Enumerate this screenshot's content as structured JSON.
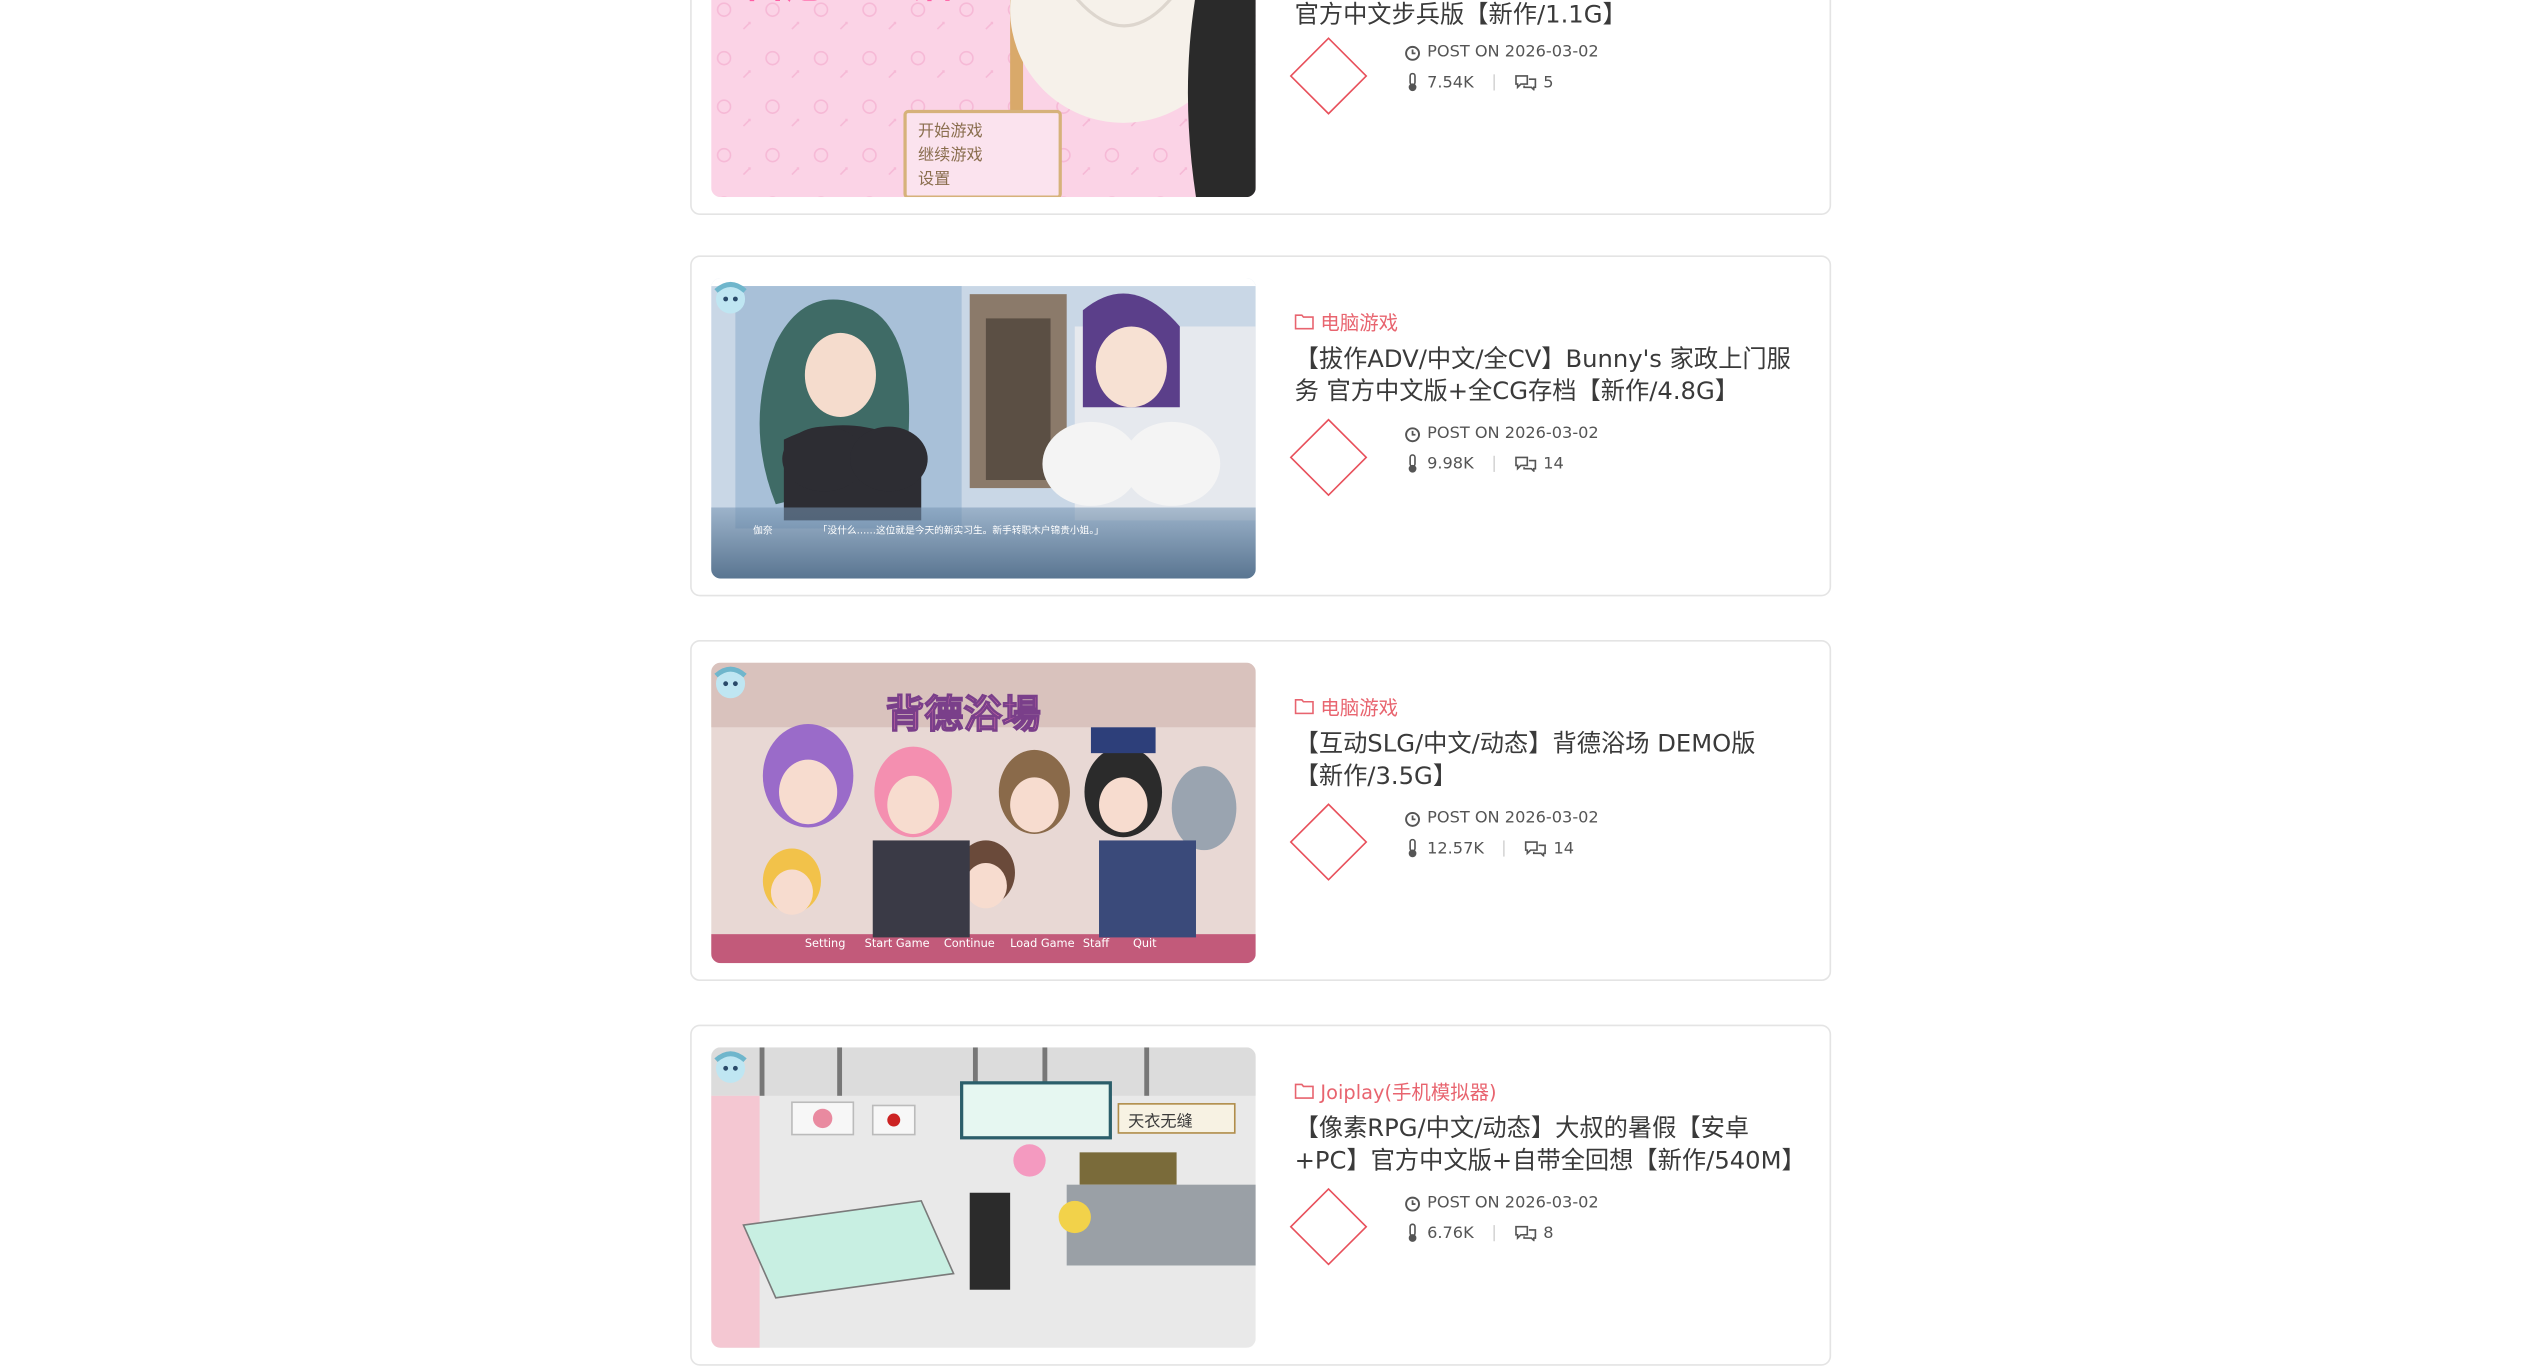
{
  "posts": [
    {
      "category": "",
      "title": "官方中文步兵版【新作/1.1G】",
      "date": "POST ON 2026-03-02",
      "views": "7.54K",
      "comments": "5",
      "thumb_menu": [
        "开始游戏",
        "继续游戏",
        "设置"
      ]
    },
    {
      "category": "电脑游戏",
      "title": "【拔作ADV/中文/全CV】Bunny's 家政上门服务 官方中文版+全CG存档【新作/4.8G】",
      "date": "POST ON 2026-03-02",
      "views": "9.98K",
      "comments": "14",
      "thumb_speaker": "伽奈",
      "thumb_dialog": "「没什么……这位就是今天的新实习生。新手转职木户锦贵小姐。」"
    },
    {
      "category": "电脑游戏",
      "title": "【互动SLG/中文/动态】背德浴场 DEMO版【新作/3.5G】",
      "date": "POST ON 2026-03-02",
      "views": "12.57K",
      "comments": "14",
      "thumb_logo": "背德浴場",
      "thumb_menu": [
        "Setting",
        "Start Game",
        "Continue",
        "Load Game",
        "Staff",
        "Quit"
      ]
    },
    {
      "category": "Joiplay(手机模拟器)",
      "title": "【像素RPG/中文/动态】大叔的暑假【安卓+PC】官方中文版+自带全回想【新作/540M】",
      "date": "POST ON 2026-03-02",
      "views": "6.76K",
      "comments": "8",
      "thumb_sign": "天衣无缝"
    }
  ],
  "colors": {
    "accent": "#e8646f",
    "diamond": "#e8505b",
    "text": "#3a3a3a",
    "border": "#e4e4e4"
  },
  "icons": {
    "category": "folder-icon",
    "date": "clock-icon",
    "views": "thermometer-icon",
    "comments": "chat-bubbles-icon"
  }
}
